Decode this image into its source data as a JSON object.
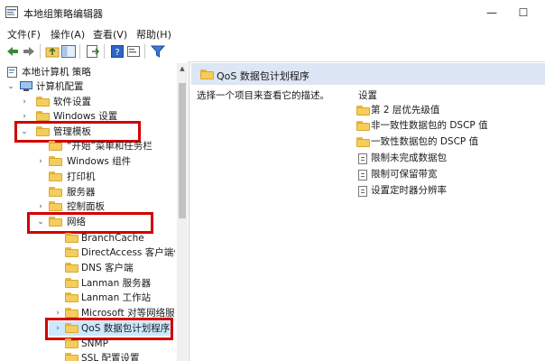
{
  "window": {
    "title": "本地组策略编辑器",
    "minimize": "—",
    "maximize": "☐"
  },
  "menubar": [
    "文件(F)",
    "操作(A)",
    "查看(V)",
    "帮助(H)"
  ],
  "toolbar": [
    "back-icon",
    "forward-icon",
    "up-folder-icon",
    "show-hide-tree-icon",
    "export-list-icon",
    "help-icon",
    "properties-icon",
    "filter-icon"
  ],
  "tree": {
    "root": "本地计算机 策略",
    "computer_config": "计算机配置",
    "software_settings": "软件设置",
    "windows_settings": "Windows 设置",
    "admin_templates": "管理模板",
    "start_menu": "“开始”菜单和任务栏",
    "windows_components": "Windows 组件",
    "printers": "打印机",
    "server": "服务器",
    "control_panel": "控制面板",
    "network": "网络",
    "branchcache": "BranchCache",
    "directaccess": "DirectAccess 客户端体验",
    "dns_client": "DNS 客户端",
    "lanman_server": "Lanman 服务器",
    "lanman_workstation": "Lanman 工作站",
    "microsoft_peer": "Microsoft 对等网络服务",
    "qos": "QoS 数据包计划程序",
    "snmp": "SNMP",
    "ssl": "SSL 配置设置"
  },
  "right": {
    "header_title": "QoS 数据包计划程序",
    "description": "选择一个项目来查看它的描述。",
    "settings_header": "设置",
    "items": [
      "第 2 层优先级值",
      "非一致性数据包的 DSCP 值",
      "一致性数据包的 DSCP 值",
      "限制未完成数据包",
      "限制可保留带宽",
      "设置定时器分辨率"
    ]
  },
  "colors": {
    "highlight": "#d10000",
    "header_bg": "#dce6f4",
    "folder": "#f4cd5c"
  }
}
